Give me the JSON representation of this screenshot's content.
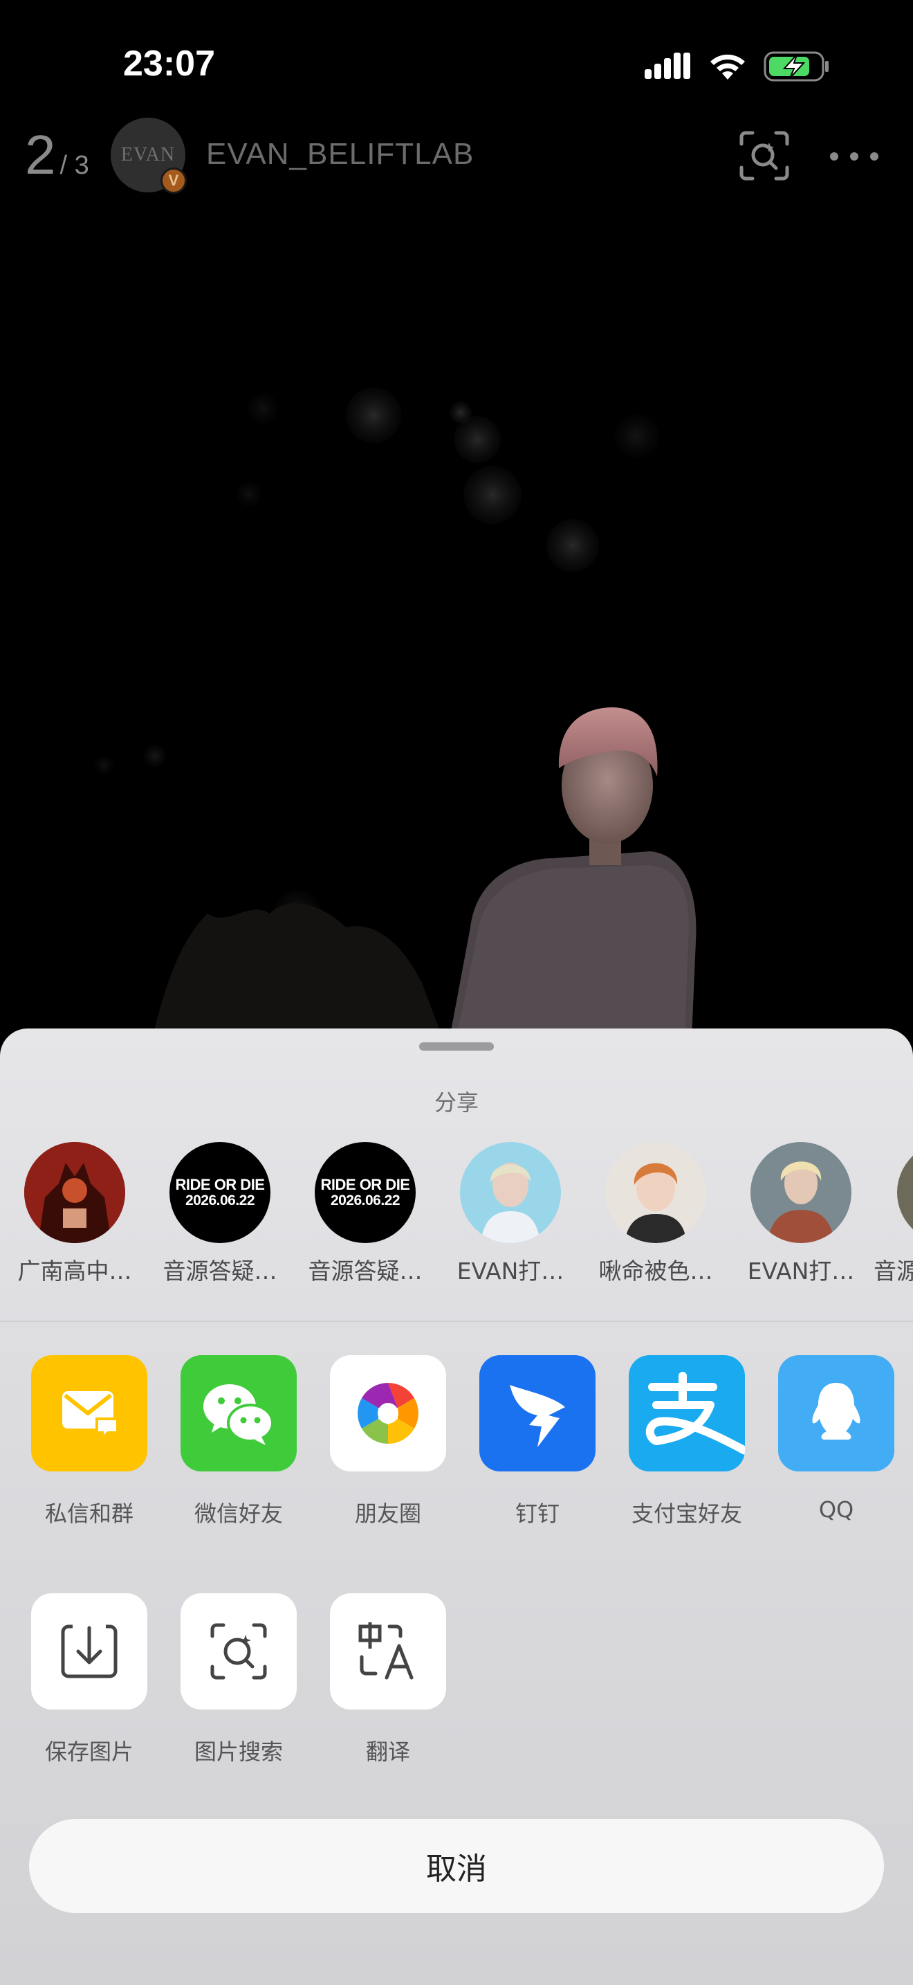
{
  "status_bar": {
    "time": "23:07",
    "icons": [
      "cellular-signal-icon",
      "wifi-icon",
      "battery-charging-icon"
    ]
  },
  "viewer": {
    "page_current": "2",
    "page_total": "/ 3",
    "avatar_text": "EVAN",
    "verified_badge": "V",
    "username": "EVAN_BELIFTLAB",
    "icons": [
      "image-scan-icon",
      "more-icon"
    ]
  },
  "share_sheet": {
    "title": "分享",
    "contacts": [
      {
        "name": "广南高中…",
        "avatar": "red-demon-art"
      },
      {
        "name": "音源答疑…",
        "avatar": "ride-or-die",
        "line1": "RIDE OR DIE",
        "line2": "2026.06.22"
      },
      {
        "name": "音源答疑…",
        "avatar": "ride-or-die",
        "line1": "RIDE OR DIE",
        "line2": "2026.06.22"
      },
      {
        "name": "EVAN打…",
        "avatar": "photo-blonde-blue"
      },
      {
        "name": "啾命被色…",
        "avatar": "photo-orange-hair"
      },
      {
        "name": "EVAN打…",
        "avatar": "photo-blonde-jacket"
      },
      {
        "name": "音源",
        "avatar": "photo-partial"
      }
    ],
    "apps": [
      {
        "label": "私信和群",
        "icon": "message-envelope-icon",
        "color": "#FFC300"
      },
      {
        "label": "微信好友",
        "icon": "wechat-icon",
        "color": "#3FCB3A"
      },
      {
        "label": "朋友圈",
        "icon": "moments-aperture-icon",
        "color": "#FFFFFF"
      },
      {
        "label": "钉钉",
        "icon": "dingtalk-icon",
        "color": "#1A72F0"
      },
      {
        "label": "支付宝好友",
        "icon": "alipay-icon",
        "color": "#1AAAF0"
      },
      {
        "label": "QQ",
        "icon": "qq-penguin-icon",
        "color": "#42ADF5"
      }
    ],
    "tools": [
      {
        "label": "保存图片",
        "icon": "download-icon"
      },
      {
        "label": "图片搜索",
        "icon": "image-search-icon"
      },
      {
        "label": "翻译",
        "icon": "translate-icon"
      }
    ],
    "cancel_label": "取消"
  }
}
